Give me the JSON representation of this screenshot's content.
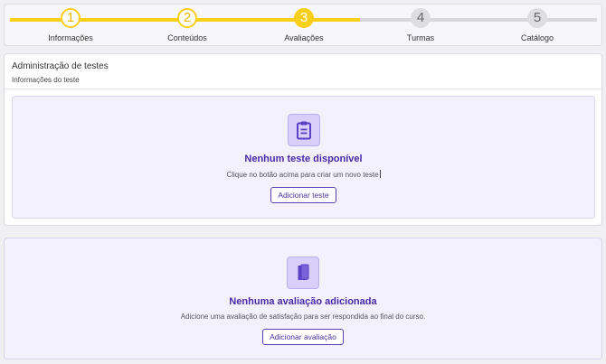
{
  "stepper": {
    "steps": [
      {
        "number": "1",
        "label": "Informações",
        "state": "done"
      },
      {
        "number": "2",
        "label": "Conteúdos",
        "state": "done"
      },
      {
        "number": "3",
        "label": "Avaliações",
        "state": "current"
      },
      {
        "number": "4",
        "label": "Turmas",
        "state": "todo"
      },
      {
        "number": "5",
        "label": "Catálogo",
        "state": "todo"
      }
    ]
  },
  "tests_panel": {
    "title": "Administração de testes",
    "subtitle": "Informações do teste",
    "empty": {
      "icon": "clipboard-icon",
      "title": "Nenhum teste disponível",
      "text": "Clique no botão acima para criar um novo teste",
      "button_label": "Adicionar teste"
    }
  },
  "evaluation_panel": {
    "empty": {
      "icon": "book-icon",
      "title": "Nenhuma avaliação adicionada",
      "text": "Adicione uma avaliação de satisfação para ser respondida ao final do curso.",
      "button_label": "Adicionar avaliação"
    }
  },
  "colors": {
    "progress": "#f9cf1a",
    "track": "#d7d7dc",
    "accent": "#4a28a8",
    "empty_bg": "#f3f1fd",
    "icon_tile": "#d8d0fb"
  }
}
